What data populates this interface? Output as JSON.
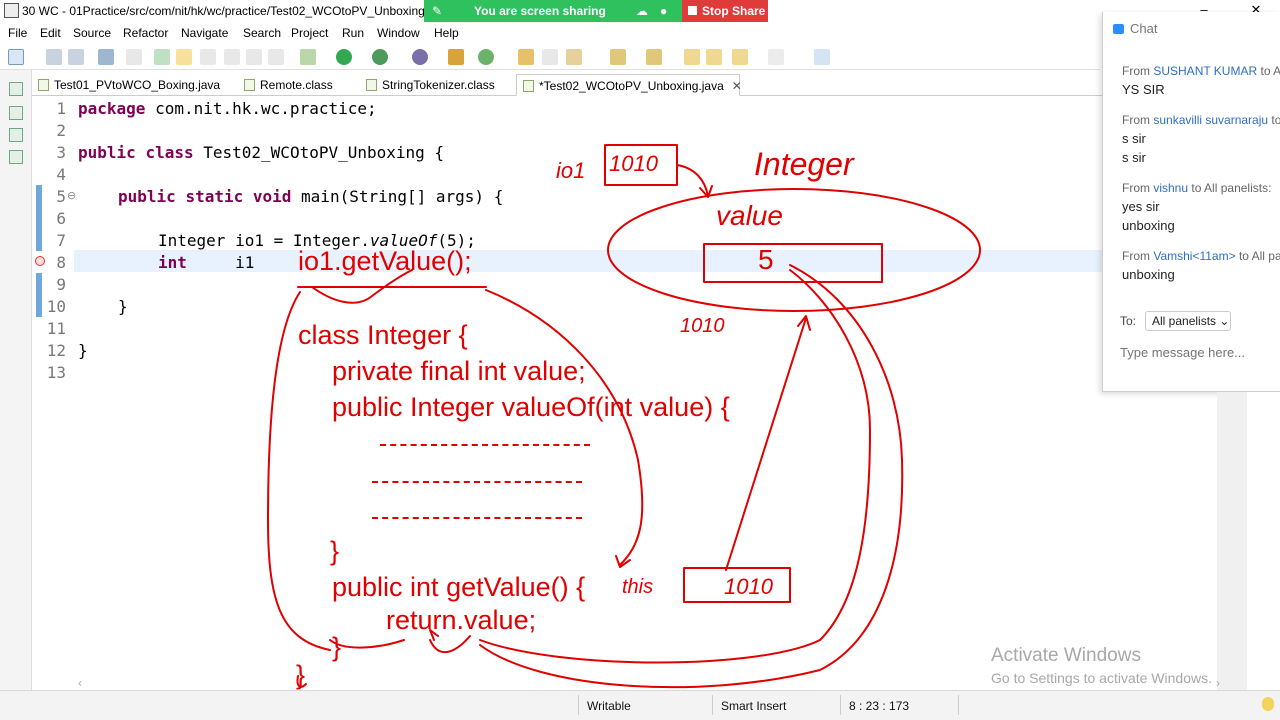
{
  "window": {
    "title": "30 WC - 01Practice/src/com/nit/hk/wc/practice/Test02_WCOtoPV_Unboxing",
    "controls": [
      "–",
      "❐",
      "✕"
    ]
  },
  "screen_share": {
    "status": "You are screen sharing",
    "stop_label": "Stop Share"
  },
  "menu": [
    "File",
    "Edit",
    "Source",
    "Refactor",
    "Navigate",
    "Search",
    "Project",
    "Run",
    "Window",
    "Help"
  ],
  "tabs": [
    {
      "label": "Test01_PVtoWCO_Boxing.java"
    },
    {
      "label": "Remote.class"
    },
    {
      "label": "StringTokenizer.class"
    },
    {
      "label": "*Test02_WCOtoPV_Unboxing.java",
      "close": "✕"
    }
  ],
  "editor": {
    "line_numbers": [
      "1",
      "2",
      "3",
      "4",
      "5",
      "6",
      "7",
      "8",
      "9",
      "10",
      "11",
      "12",
      "13"
    ],
    "fold_marker": "⊖",
    "lines": {
      "l1_kw": "package",
      "l1_rest": " com.nit.hk.wc.practice;",
      "l3_kw1": "public",
      "l3_kw2": "class",
      "l3_rest": " Test02_WCOtoPV_Unboxing {",
      "l5_kw1": "public",
      "l5_kw2": "static",
      "l5_kw3": "void",
      "l5_rest": " main(String[] args) {",
      "l7_a": "Integer io1 = Integer.",
      "l7_it": "valueOf",
      "l7_b": "(5);",
      "l8_kw": "int",
      "l8_rest": "     i1  ",
      "l10": "}",
      "l12": "}"
    }
  },
  "annotations": {
    "getvalue_call": "io1.getValue();",
    "io1_label": "io1",
    "addr_box": "1010",
    "integer_label": "Integer",
    "value_label": "value",
    "value_box": "5",
    "addr_below": "1010",
    "class_code": [
      "class Integer {",
      "private final int value;",
      "public Integer valueOf(int value) {",
      "}",
      "public int getValue() {",
      "return.value;",
      "}",
      "}"
    ],
    "this_label": "this",
    "this_box": "1010"
  },
  "chat": {
    "title": "Chat",
    "messages": [
      {
        "from": "From",
        "name": "SUSHANT KUMAR",
        "to": "to All",
        "text": [
          "YS SIR"
        ]
      },
      {
        "from": "From",
        "name": "sunkavilli suvarnaraju",
        "to": "to",
        "text": [
          "s sir",
          "s sir"
        ]
      },
      {
        "from": "From",
        "name": "vishnu",
        "to": "to All panelists:",
        "text": [
          "yes sir",
          "unboxing"
        ]
      },
      {
        "from": "From",
        "name": "Vamshi<11am>",
        "to": "to All pa",
        "text": [
          "unboxing"
        ]
      }
    ],
    "to_label": "To:",
    "to_value": "All panelists",
    "input_placeholder": "Type message here..."
  },
  "watermark": {
    "line1": "Activate Windows",
    "line2": "Go to Settings to activate Windows."
  },
  "status": {
    "writable": "Writable",
    "insert_mode": "Smart Insert",
    "position": "8 : 23 : 173"
  },
  "colors": {
    "keyword": "#7f0055",
    "annotation": "#e00000",
    "share_green": "#2fc15e",
    "stop_red": "#e03b3b",
    "chat_name": "#2d6fc2"
  }
}
